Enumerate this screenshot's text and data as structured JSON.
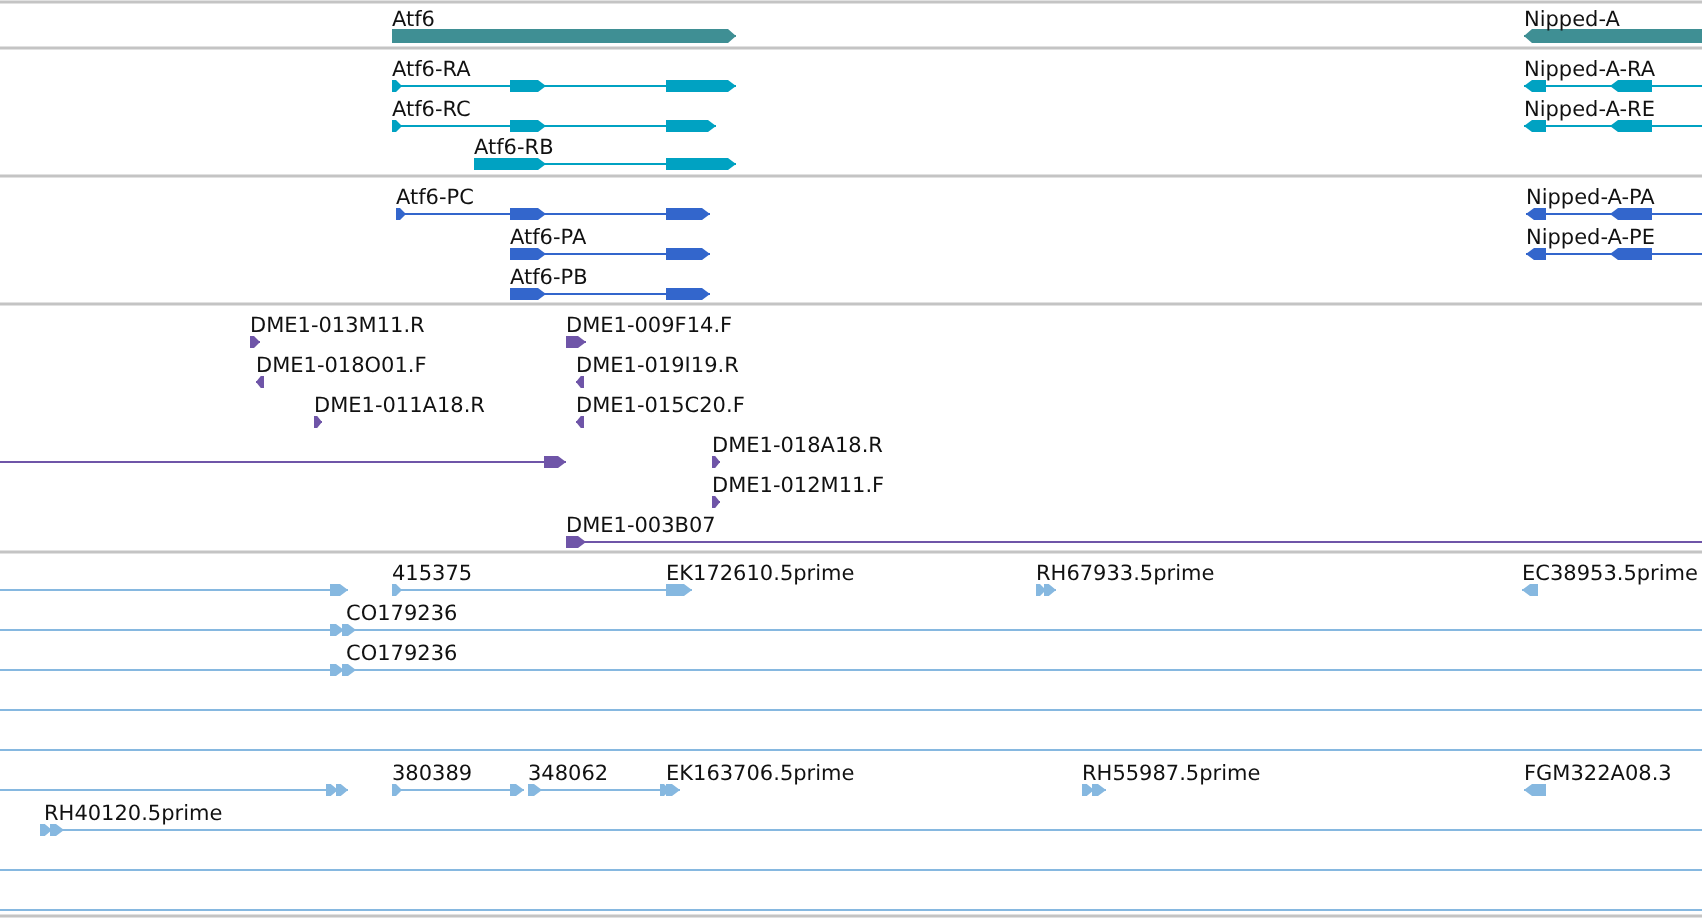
{
  "tracks": [
    {
      "kind": "gene",
      "features": [
        {
          "kind": "read",
          "label": "Atf6",
          "reverse": false
        },
        {
          "kind": "read",
          "label": "Nipped-A",
          "reverse": true
        }
      ]
    },
    {
      "kind": "transcript",
      "features": [
        {
          "kind": "read",
          "label": "Atf6-RA",
          "reverse": false
        },
        {
          "kind": "read",
          "label": "Atf6-RC",
          "reverse": false
        },
        {
          "kind": "read",
          "label": "Atf6-RB",
          "reverse": false
        },
        {
          "kind": "read",
          "label": "Nipped-A-RA",
          "reverse": true
        },
        {
          "kind": "read",
          "label": "Nipped-A-RE",
          "reverse": true
        }
      ]
    },
    {
      "kind": "protein",
      "features": [
        {
          "kind": "read",
          "label": "Atf6-PC",
          "reverse": false
        },
        {
          "kind": "read",
          "label": "Atf6-PA",
          "reverse": false
        },
        {
          "kind": "read",
          "label": "Atf6-PB",
          "reverse": false
        },
        {
          "kind": "read",
          "label": "Nipped-A-PA",
          "reverse": true
        },
        {
          "kind": "read",
          "label": "Nipped-A-PE",
          "reverse": true
        }
      ]
    },
    {
      "kind": "clone",
      "features": [
        {
          "kind": "read",
          "label": "DME1-013M11.R",
          "reverse": false
        },
        {
          "kind": "read",
          "label": "DME1-018O01.F",
          "reverse": true
        },
        {
          "kind": "read",
          "label": "DME1-011A18.R",
          "reverse": false
        },
        {
          "kind": "read",
          "reverse": false
        },
        {
          "kind": "read",
          "label": "DME1-009F14.F",
          "reverse": false
        },
        {
          "kind": "read",
          "label": "DME1-019I19.R",
          "reverse": true
        },
        {
          "kind": "read",
          "label": "DME1-015C20.F",
          "reverse": true
        },
        {
          "kind": "read",
          "label": "DME1-018A18.R",
          "reverse": false
        },
        {
          "kind": "read",
          "label": "DME1-012M11.F",
          "reverse": false
        },
        {
          "kind": "read",
          "label": "DME1-003B07",
          "reverse": false
        }
      ]
    },
    {
      "kind": "est",
      "features": [
        {
          "kind": "read",
          "reverse": false
        },
        {
          "kind": "read",
          "label": "415375",
          "reverse": false
        },
        {
          "kind": "read",
          "label": "EK172610.5prime",
          "reverse": false
        },
        {
          "kind": "read",
          "label": "RH67933.5prime",
          "reverse": false
        },
        {
          "kind": "read",
          "label": "EC38953.5prime",
          "reverse": true
        },
        {
          "kind": "read",
          "label": "CO179236",
          "reverse": false
        },
        {
          "kind": "read",
          "label": "CO179236",
          "reverse": false
        },
        {
          "kind": "span"
        },
        {
          "kind": "span"
        },
        {
          "kind": "read",
          "reverse": false
        },
        {
          "kind": "read",
          "label": "380389",
          "reverse": false
        },
        {
          "kind": "read",
          "label": "348062",
          "reverse": false
        },
        {
          "kind": "read",
          "label": "EK163706.5prime",
          "reverse": false
        },
        {
          "kind": "read",
          "label": "RH55987.5prime",
          "reverse": false
        },
        {
          "kind": "read",
          "label": "FGM322A08.3",
          "reverse": true
        },
        {
          "kind": "read",
          "label": "RH40120.5prime",
          "reverse": false
        },
        {
          "kind": "span"
        },
        {
          "kind": "span"
        }
      ]
    }
  ]
}
